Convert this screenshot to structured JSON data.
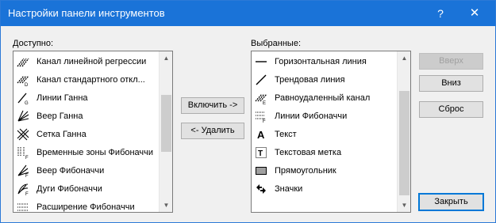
{
  "window": {
    "title": "Настройки панели инструментов",
    "help_label": "?",
    "close_label": "✕"
  },
  "available": {
    "label": "Доступно:",
    "items": [
      {
        "label": "Канал линейной регрессии",
        "icon": "linear-regression-channel-icon"
      },
      {
        "label": "Канал стандартного откл...",
        "icon": "std-deviation-channel-icon"
      },
      {
        "label": "Линии Ганна",
        "icon": "gann-lines-icon"
      },
      {
        "label": "Веер Ганна",
        "icon": "gann-fan-icon"
      },
      {
        "label": "Сетка Ганна",
        "icon": "gann-grid-icon"
      },
      {
        "label": "Временные зоны Фибоначчи",
        "icon": "fibonacci-time-zones-icon"
      },
      {
        "label": "Веер Фибоначчи",
        "icon": "fibonacci-fan-icon"
      },
      {
        "label": "Дуги Фибоначчи",
        "icon": "fibonacci-arcs-icon"
      },
      {
        "label": "Расширение Фибоначчи",
        "icon": "fibonacci-expansion-icon"
      }
    ]
  },
  "selected": {
    "label": "Выбранные:",
    "items": [
      {
        "label": "Горизонтальная линия",
        "icon": "horizontal-line-icon"
      },
      {
        "label": "Трендовая линия",
        "icon": "trend-line-icon"
      },
      {
        "label": "Равноудаленный канал",
        "icon": "equidistant-channel-icon"
      },
      {
        "label": "Линии Фибоначчи",
        "icon": "fibonacci-lines-icon"
      },
      {
        "label": "Текст",
        "icon": "text-icon"
      },
      {
        "label": "Текстовая метка",
        "icon": "text-label-icon"
      },
      {
        "label": "Прямоугольник",
        "icon": "rectangle-icon"
      },
      {
        "label": "Значки",
        "icon": "arrows-icon"
      }
    ]
  },
  "buttons": {
    "include": "Включить ->",
    "remove": "<- Удалить",
    "up": "Вверх",
    "down": "Вниз",
    "reset": "Сброс",
    "close": "Закрыть"
  },
  "colors": {
    "titlebar": "#1a73d8",
    "accent": "#0078d7"
  }
}
